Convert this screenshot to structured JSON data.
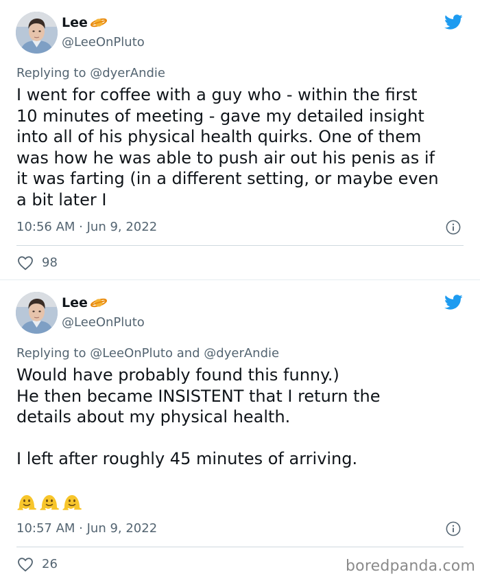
{
  "tweets": [
    {
      "user": {
        "name": "Lee",
        "handle": "@LeeOnPluto",
        "name_emoji": "ringed-planet-icon"
      },
      "replying": {
        "prefix": "Replying to",
        "mentions": "@dyerAndie"
      },
      "text": "I went for coffee with a guy who - within the first\n10 minutes of meeting - gave my detailed insight\ninto all of his physical health quirks.  One of them\nwas how he was able to push air out his penis as if\nit was farting (in a different setting, or maybe even\na bit later I",
      "timestamp": "10:56 AM · Jun 9, 2022",
      "likes": "98"
    },
    {
      "user": {
        "name": "Lee",
        "handle": "@LeeOnPluto",
        "name_emoji": "ringed-planet-icon"
      },
      "replying": {
        "prefix": "Replying to",
        "mentions": "@LeeOnPluto and @dyerAndie"
      },
      "text": "Would have probably found this funny.)\nHe then became INSISTENT that I return the\ndetails about my physical health.\n\nI left after roughly 45 minutes of arriving.",
      "emojis": [
        "melting-face-icon",
        "melting-face-icon",
        "melting-face-icon"
      ],
      "timestamp": "10:57 AM · Jun 9, 2022",
      "likes": "26"
    }
  ],
  "watermark": "boredpanda.com",
  "colors": {
    "twitter_blue": "#1d9bf0",
    "muted": "#536471",
    "text": "#0f1419",
    "divider": "#cfd9de"
  }
}
